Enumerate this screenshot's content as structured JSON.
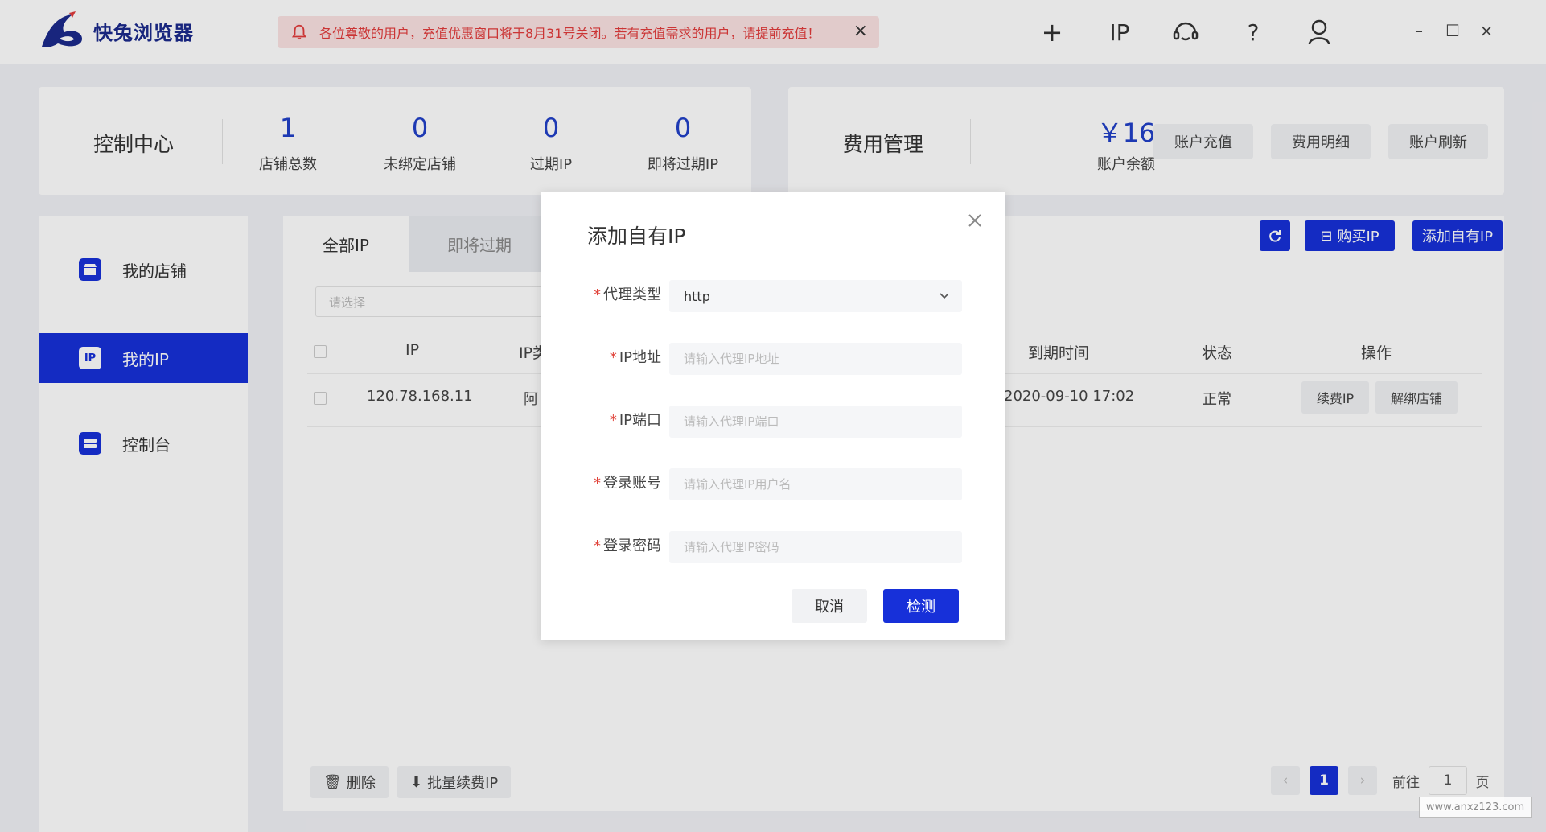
{
  "app": {
    "name": "快兔浏览器"
  },
  "notice": {
    "text": "各位尊敬的用户，充值优惠窗口将于8月31号关闭。若有充值需求的用户，请提前充值！",
    "close": "×"
  },
  "toolbar": {
    "add": "+",
    "ip": "IP",
    "help": "?",
    "minimize": "–",
    "maximize": "☐",
    "close": "×"
  },
  "control_center": {
    "title": "控制中心",
    "stats": [
      {
        "value": "1",
        "label": "店铺总数"
      },
      {
        "value": "0",
        "label": "未绑定店铺"
      },
      {
        "value": "0",
        "label": "过期IP"
      },
      {
        "value": "0",
        "label": "即将过期IP"
      }
    ]
  },
  "fees": {
    "title": "费用管理",
    "balance_value": "￥16",
    "balance_label": "账户余额",
    "buttons": [
      "账户充值",
      "费用明细",
      "账户刷新"
    ]
  },
  "sidebar": {
    "items": [
      {
        "label": "我的店铺",
        "active": false
      },
      {
        "label": "我的IP",
        "active": true
      },
      {
        "label": "控制台",
        "active": false
      }
    ]
  },
  "main": {
    "tabs": [
      {
        "label": "全部IP"
      },
      {
        "label": "即将过期"
      }
    ],
    "select_placeholder": "请选择",
    "buy_ip": "购买IP",
    "add_own_ip": "添加自有IP",
    "columns": {
      "ip": "IP",
      "ip_type": "IP类",
      "expire": "到期时间",
      "status": "状态",
      "ops": "操作"
    },
    "rows": [
      {
        "ip": "120.78.168.11",
        "ip_type": "阿",
        "expire": "2020-09-10 17:02",
        "status": "正常",
        "op_renew": "续费IP",
        "op_unbind": "解绑店铺"
      }
    ],
    "footer": {
      "delete": "删除",
      "batch_renew": "批量续费IP"
    },
    "pagination": {
      "prev": "‹",
      "current": "1",
      "next": "›",
      "goto_label": "前往",
      "goto_value": "1",
      "page_suffix": "页"
    }
  },
  "dialog": {
    "title": "添加自有IP",
    "fields": [
      {
        "label": "代理类型",
        "value": "http",
        "placeholder": ""
      },
      {
        "label": "IP地址",
        "value": "",
        "placeholder": "请输入代理IP地址"
      },
      {
        "label": "IP端口",
        "value": "",
        "placeholder": "请输入代理IP端口"
      },
      {
        "label": "登录账号",
        "value": "",
        "placeholder": "请输入代理IP用户名"
      },
      {
        "label": "登录密码",
        "value": "",
        "placeholder": "请输入代理IP密码"
      }
    ],
    "required_mark": "*",
    "cancel": "取消",
    "check": "检测"
  },
  "watermark": "www.anxz123.com",
  "colors": {
    "primary": "#1730d9",
    "number_blue": "#2140c8",
    "notice_bg": "#fbe3e3",
    "notice_text": "#e23c3c",
    "required": "#e0433a"
  },
  "icons": {
    "logo": "rabbit-logo-icon",
    "bell": "bell-icon",
    "add": "plus-icon",
    "ip": "ip-icon",
    "support": "headset-icon",
    "help": "question-icon",
    "user": "user-icon",
    "store": "store-icon",
    "myip": "ip-badge-icon",
    "console": "console-icon",
    "refresh": "refresh-icon",
    "delete": "trash-icon",
    "renew": "renew-icon",
    "close": "close-icon",
    "chevron": "chevron-down-icon"
  }
}
